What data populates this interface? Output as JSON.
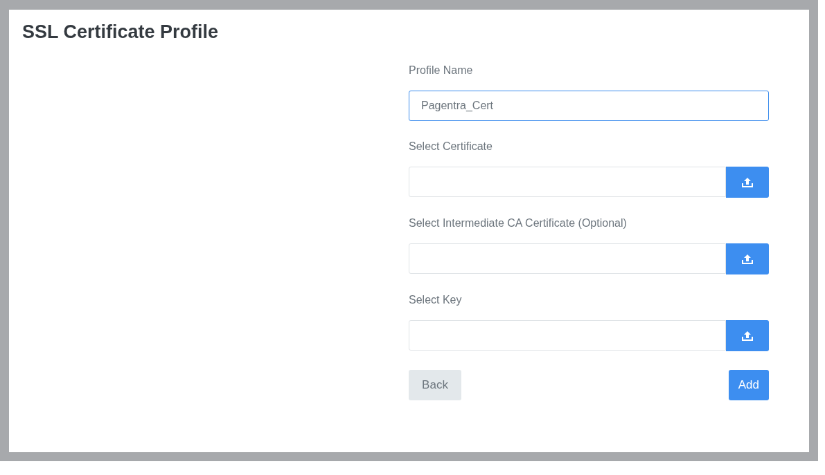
{
  "title": "SSL Certificate Profile",
  "fields": [
    {
      "kind": "text",
      "label": "Profile Name",
      "value": "Pagentra_Cert",
      "focused": true
    },
    {
      "kind": "file",
      "label": "Select Certificate",
      "focused": false
    },
    {
      "kind": "file",
      "label": "Select Intermediate CA Certificate (Optional)",
      "focused": false
    },
    {
      "kind": "file",
      "label": "Select Key",
      "focused": false
    }
  ],
  "buttons": [
    {
      "label": "Back",
      "kind": "secondary"
    },
    {
      "label": "Add",
      "kind": "primary"
    }
  ]
}
